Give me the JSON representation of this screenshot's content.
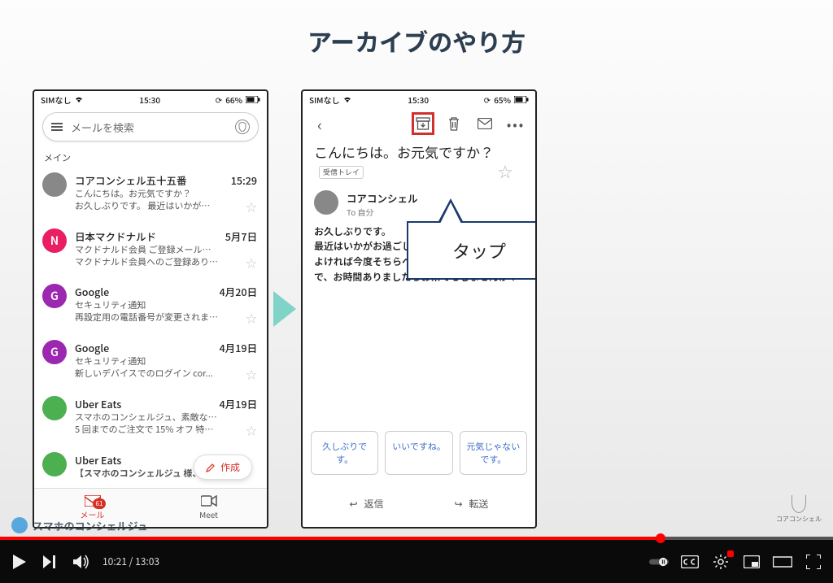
{
  "slide": {
    "title": "アーカイブのやり方",
    "callout": "タップ",
    "watermark": "コアコンシェル",
    "channel_overlay": "スマホのコンシェルジュ"
  },
  "phone1": {
    "status": {
      "carrier": "SIMなし",
      "time": "15:30",
      "battery": "66%"
    },
    "search_placeholder": "メールを検索",
    "section": "メイン",
    "compose": "作成",
    "tabs": {
      "mail": "メール",
      "meet": "Meet",
      "badge": "61"
    },
    "mails": [
      {
        "avatar": "",
        "avclass": "av-gray",
        "sender": "コアコンシェル五十五番",
        "date": "15:29",
        "line1": "こんにちは。お元気ですか？",
        "line2": "お久しぶりです。 最近はいかが…"
      },
      {
        "avatar": "N",
        "avclass": "av-pink",
        "sender": "日本マクドナルド",
        "date": "5月7日",
        "line1": "マクドナルド会員 ご登録メール…",
        "line2": "マクドナルド会員へのご登録あり…"
      },
      {
        "avatar": "G",
        "avclass": "av-purple",
        "sender": "Google",
        "date": "4月20日",
        "line1": "セキュリティ通知",
        "line2": "再設定用の電話番号が変更されま…"
      },
      {
        "avatar": "G",
        "avclass": "av-purple",
        "sender": "Google",
        "date": "4月19日",
        "line1": "セキュリティ通知",
        "line2": "新しいデバイスでのログイン cor..."
      },
      {
        "avatar": "",
        "avclass": "av-green",
        "sender": "Uber Eats",
        "date": "4月19日",
        "line1": "スマホのコンシェルジュ、素敵な…",
        "line2": "5 回までのご注文で 15% オフ 特…"
      },
      {
        "avatar": "",
        "avclass": "av-green",
        "sender": "Uber Eats",
        "date": "",
        "line1": "【スマホのコンシェルジュ 様、",
        "line2": ""
      }
    ]
  },
  "phone2": {
    "status": {
      "carrier": "SIMなし",
      "time": "15:30",
      "battery": "65%"
    },
    "title": "こんにちは。お元気ですか？",
    "inbox_chip": "受信トレイ",
    "sender": "コアコンシェル",
    "to": "To 自分",
    "body": "お久しぶりです。\n最近はいかがお過ごしですか？\nよければ今度そちらへ伺う機会がありますので、お時間ありましたらお茶でもしませんか？",
    "quick_replies": [
      "久しぶりです。",
      "いいですね。",
      "元気じゃないです。"
    ],
    "reply": "返信",
    "forward": "転送"
  },
  "player": {
    "current": "10:21",
    "total": "13:03"
  }
}
